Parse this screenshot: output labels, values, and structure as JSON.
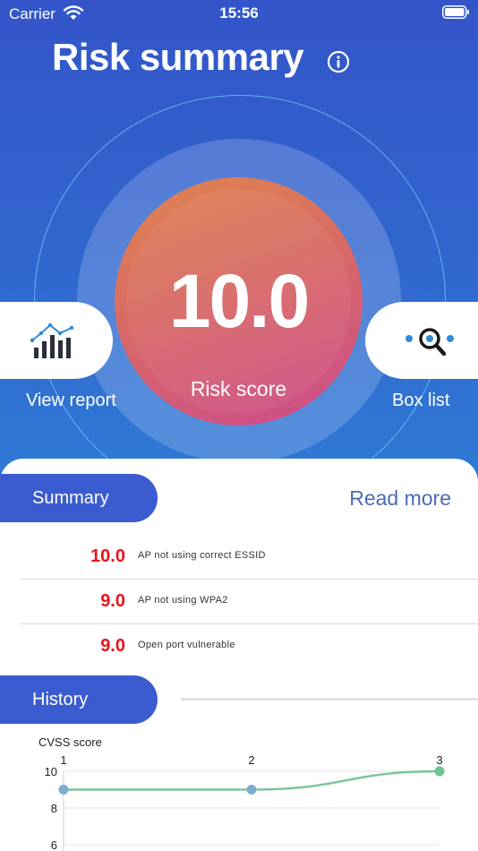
{
  "status_bar": {
    "carrier": "Carrier",
    "time": "15:56"
  },
  "header": {
    "title": "Risk summary"
  },
  "risk": {
    "score": "10.0",
    "label": "Risk score"
  },
  "actions": {
    "view_report": "View report",
    "box_list": "Box list"
  },
  "summary": {
    "tab_label": "Summary",
    "read_more": "Read more",
    "items": [
      {
        "score": "10.0",
        "text": "AP not using correct ESSID"
      },
      {
        "score": "9.0",
        "text": "AP not using WPA2"
      },
      {
        "score": "9.0",
        "text": "Open port vulnerable"
      }
    ]
  },
  "history": {
    "tab_label": "History"
  },
  "colors": {
    "accent": "#3b5cd0",
    "risk_red": "#e8141c",
    "line": "#7dc59a",
    "point_blue": "#7aaed0",
    "point_green": "#6cc38d"
  },
  "chart_data": {
    "type": "line",
    "ylabel": "CVSS score",
    "x": [
      1,
      2,
      3
    ],
    "series": [
      {
        "values": [
          9,
          9,
          10
        ]
      }
    ],
    "yticks": [
      10,
      8,
      6
    ],
    "ylim": [
      6,
      10
    ],
    "x_labels_position": "top",
    "grid": true
  }
}
